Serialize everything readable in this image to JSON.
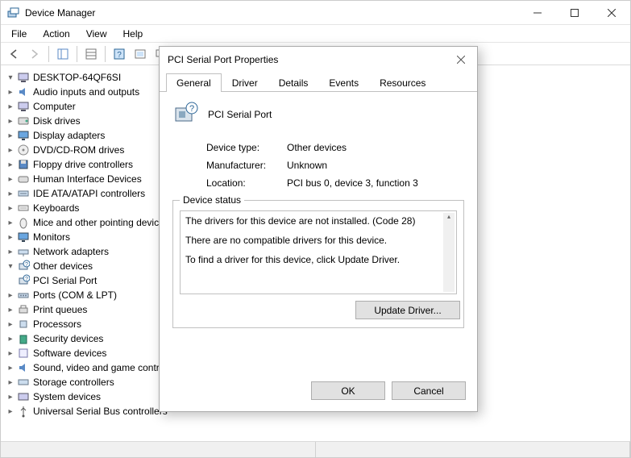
{
  "titlebar": {
    "title": "Device Manager"
  },
  "menubar": [
    "File",
    "Action",
    "View",
    "Help"
  ],
  "tree": {
    "root": "DESKTOP-64QF6SI",
    "items": [
      "Audio inputs and outputs",
      "Computer",
      "Disk drives",
      "Display adapters",
      "DVD/CD-ROM drives",
      "Floppy drive controllers",
      "Human Interface Devices",
      "IDE ATA/ATAPI controllers",
      "Keyboards",
      "Mice and other pointing devices",
      "Monitors",
      "Network adapters",
      "Other devices",
      "Ports (COM & LPT)",
      "Print queues",
      "Processors",
      "Security devices",
      "Software devices",
      "Sound, video and game controllers",
      "Storage controllers",
      "System devices",
      "Universal Serial Bus controllers"
    ],
    "other_child": "PCI Serial Port"
  },
  "dialog": {
    "title": "PCI Serial Port Properties",
    "tabs": [
      "General",
      "Driver",
      "Details",
      "Events",
      "Resources"
    ],
    "device_name": "PCI Serial Port",
    "rows": {
      "type_k": "Device type:",
      "type_v": "Other devices",
      "mfr_k": "Manufacturer:",
      "mfr_v": "Unknown",
      "loc_k": "Location:",
      "loc_v": "PCI bus 0, device 3, function 3"
    },
    "status_legend": "Device status",
    "status_line1": "The drivers for this device are not installed. (Code 28)",
    "status_line2": "There are no compatible drivers for this device.",
    "status_line3": "To find a driver for this device, click Update Driver.",
    "update_btn": "Update Driver...",
    "ok": "OK",
    "cancel": "Cancel"
  }
}
